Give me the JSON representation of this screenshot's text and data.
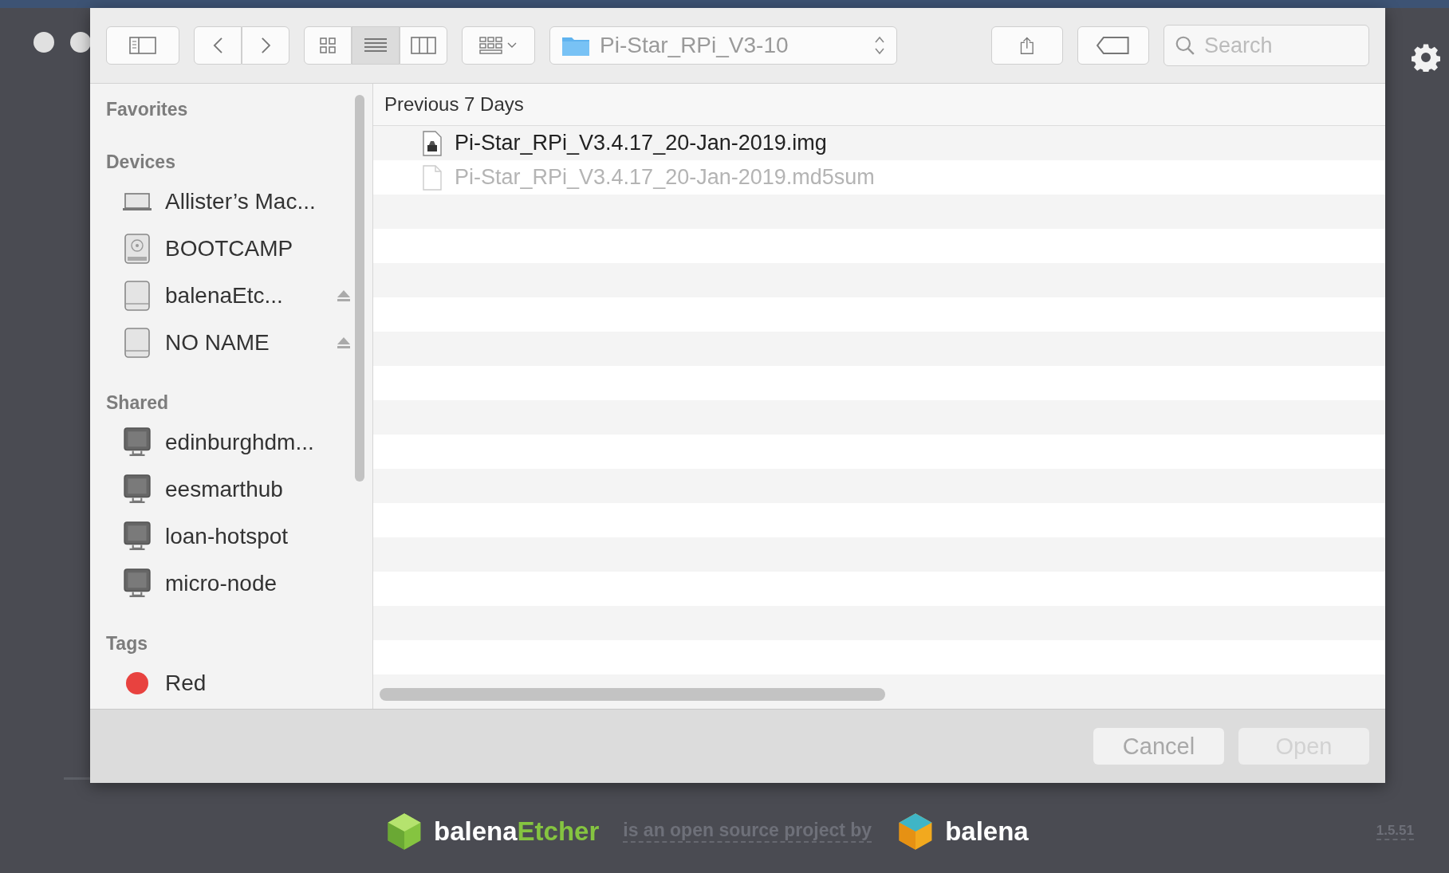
{
  "app": {
    "footer": {
      "brand_first": "balena",
      "brand_second": "Etcher",
      "tagline": "is an open source project by",
      "company": "balena",
      "version": "1.5.51"
    }
  },
  "dialog": {
    "toolbar": {
      "view_modes": [
        {
          "kind": "icons",
          "selected": false
        },
        {
          "kind": "list",
          "selected": true
        },
        {
          "kind": "columns",
          "selected": false
        }
      ],
      "location": "Pi-Star_RPi_V3-10",
      "search": {
        "placeholder": "Search"
      }
    },
    "sidebar": {
      "sections": [
        {
          "title": "Favorites"
        },
        {
          "title": "Devices",
          "items": [
            {
              "kind": "laptop",
              "label": "Allister’s Mac...",
              "eject": false
            },
            {
              "kind": "internal-disk",
              "label": "BOOTCAMP",
              "eject": false
            },
            {
              "kind": "external-disk",
              "label": "balenaEtc...",
              "eject": true
            },
            {
              "kind": "external-disk",
              "label": "NO NAME",
              "eject": true
            }
          ]
        },
        {
          "title": "Shared",
          "items": [
            {
              "kind": "computer",
              "label": "edinburghdm...",
              "eject": false
            },
            {
              "kind": "computer",
              "label": "eesmarthub",
              "eject": false
            },
            {
              "kind": "computer",
              "label": "loan-hotspot",
              "eject": false
            },
            {
              "kind": "computer",
              "label": "micro-node",
              "eject": false
            }
          ]
        },
        {
          "title": "Tags",
          "items": [
            {
              "kind": "tag",
              "label": "Red",
              "color": "#e8423f",
              "eject": false
            }
          ]
        }
      ]
    },
    "files": {
      "group": "Previous 7 Days",
      "rows": [
        {
          "name": "Pi-Star_RPi_V3.4.17_20-Jan-2019.img",
          "kind": "disk-image",
          "disabled": false
        },
        {
          "name": "Pi-Star_RPi_V3.4.17_20-Jan-2019.md5sum",
          "kind": "document",
          "disabled": true
        }
      ]
    },
    "buttons": [
      {
        "label": "Cancel",
        "disabled": false
      },
      {
        "label": "Open",
        "disabled": true
      }
    ]
  }
}
